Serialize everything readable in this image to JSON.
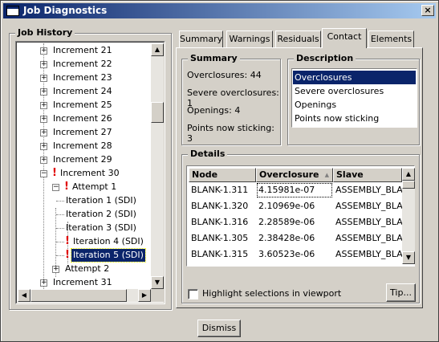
{
  "window": {
    "title": "Job Diagnostics",
    "close_glyph": "×"
  },
  "history": {
    "group_title": "Job History",
    "rows": [
      {
        "label": "Increment 21"
      },
      {
        "label": "Increment 22"
      },
      {
        "label": "Increment 23"
      },
      {
        "label": "Increment 24"
      },
      {
        "label": "Increment 25"
      },
      {
        "label": "Increment 26"
      },
      {
        "label": "Increment 27"
      },
      {
        "label": "Increment 28"
      },
      {
        "label": "Increment 29"
      },
      {
        "label": "Increment 30",
        "expander": "−",
        "warning": "!"
      },
      {
        "label": "Attempt 1",
        "expander": "−",
        "warning": "!"
      },
      {
        "label": "Iteration 1 (SDI)"
      },
      {
        "label": "Iteration 2 (SDI)"
      },
      {
        "label": "Iteration 3 (SDI)"
      },
      {
        "label": "Iteration 4 (SDI)",
        "warning": "!"
      },
      {
        "label": "Iteration 5 (SDI)",
        "warning": "!"
      },
      {
        "label": "Attempt 2",
        "expander": "+"
      },
      {
        "label": "Increment 31"
      }
    ],
    "expander_collapsed": "+"
  },
  "tabs": [
    "Summary",
    "Warnings",
    "Residuals",
    "Contact",
    "Elements"
  ],
  "active_tab": "Contact",
  "summary": {
    "title": "Summary",
    "lines": [
      "Overclosures: 44",
      "Severe overclosures: 1",
      "Openings: 4",
      "Points now sticking: 3"
    ]
  },
  "description": {
    "title": "Description",
    "items": [
      "Overclosures",
      "Severe overclosures",
      "Openings",
      "Points now sticking"
    ],
    "selected": "Overclosures"
  },
  "details": {
    "title": "Details",
    "columns": [
      "Node",
      "Overclosure",
      "Slave"
    ],
    "sort_indicator": "▲",
    "rows": [
      [
        "BLANK-1.311",
        "4.15981e-07",
        "ASSEMBLY_BLANK"
      ],
      [
        "BLANK-1.320",
        "2.10969e-06",
        "ASSEMBLY_BLANK"
      ],
      [
        "BLANK-1.316",
        "2.28589e-06",
        "ASSEMBLY_BLANK"
      ],
      [
        "BLANK-1.305",
        "2.38428e-06",
        "ASSEMBLY_BLANK"
      ],
      [
        "BLANK-1.315",
        "3.60523e-06",
        "ASSEMBLY_BLANK"
      ]
    ]
  },
  "highlight_checkbox": {
    "label": "Highlight selections in viewport",
    "checked": false
  },
  "tip_button": "Tip...",
  "dismiss_button": "Dismiss",
  "scroll_glyphs": {
    "up": "▲",
    "down": "▼",
    "left": "◀",
    "right": "▶"
  },
  "colors": {
    "selection": "#0a246a",
    "warning": "#e00000",
    "title_gradient_start": "#0a246a",
    "title_gradient_end": "#a6caf0"
  }
}
